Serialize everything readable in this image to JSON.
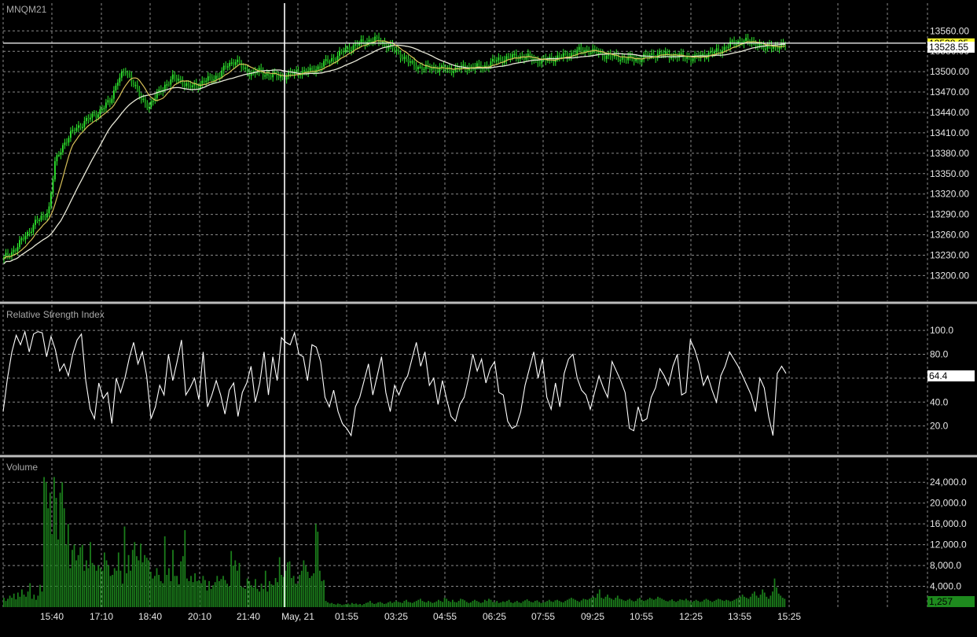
{
  "symbol": "MNQM21",
  "colors": {
    "background": "#000000",
    "candle_up": "#2ee82e",
    "candle_down": "#1a9e1a",
    "ma_fast": "#d9c25a",
    "ma_slow": "#e8e8d8",
    "rsi_line": "#ffffff",
    "volume_bar": "#1b7d1b",
    "grid": "#8a8a8a",
    "crosshair": "#ffffff",
    "last_price_tag": "#ffff33",
    "volume_tag": "#1e8a1e"
  },
  "chart_data": [
    {
      "panel": "price",
      "type": "candlestick",
      "title": "MNQM21",
      "ylim": [
        13175,
        13580
      ],
      "yticks": [
        13560,
        13530,
        13500,
        13470,
        13440,
        13410,
        13380,
        13350,
        13320,
        13290,
        13260,
        13230,
        13200
      ],
      "ytick_labels": [
        "13560.00",
        "13530.00",
        "13500.00",
        "13470.00",
        "13440.00",
        "13410.00",
        "13380.00",
        "13350.00",
        "13320.00",
        "13290.00",
        "13260.00",
        "13230.00",
        "13200.00"
      ],
      "crosshair_price": 13542,
      "crosshair_label": "13538.25",
      "last_price_label": "13528.55",
      "anchors": [
        [
          0,
          13225
        ],
        [
          6,
          13240
        ],
        [
          12,
          13262
        ],
        [
          16,
          13278
        ],
        [
          20,
          13286
        ],
        [
          23,
          13300
        ],
        [
          26,
          13365
        ],
        [
          30,
          13392
        ],
        [
          36,
          13415
        ],
        [
          42,
          13428
        ],
        [
          48,
          13440
        ],
        [
          54,
          13456
        ],
        [
          58,
          13488
        ],
        [
          62,
          13500
        ],
        [
          66,
          13485
        ],
        [
          70,
          13458
        ],
        [
          74,
          13450
        ],
        [
          78,
          13466
        ],
        [
          82,
          13480
        ],
        [
          86,
          13490
        ],
        [
          90,
          13488
        ],
        [
          94,
          13477
        ],
        [
          98,
          13480
        ],
        [
          102,
          13486
        ],
        [
          106,
          13490
        ],
        [
          110,
          13496
        ],
        [
          114,
          13510
        ],
        [
          118,
          13517
        ],
        [
          122,
          13504
        ],
        [
          126,
          13498
        ],
        [
          130,
          13500
        ],
        [
          134,
          13496
        ],
        [
          138,
          13494
        ],
        [
          142,
          13493
        ],
        [
          146,
          13496
        ],
        [
          150,
          13500
        ],
        [
          156,
          13500
        ],
        [
          162,
          13510
        ],
        [
          168,
          13520
        ],
        [
          174,
          13532
        ],
        [
          180,
          13540
        ],
        [
          186,
          13546
        ],
        [
          190,
          13547
        ],
        [
          196,
          13538
        ],
        [
          202,
          13525
        ],
        [
          208,
          13510
        ],
        [
          214,
          13505
        ],
        [
          220,
          13506
        ],
        [
          226,
          13503
        ],
        [
          232,
          13505
        ],
        [
          238,
          13507
        ],
        [
          244,
          13506
        ],
        [
          250,
          13516
        ],
        [
          256,
          13520
        ],
        [
          262,
          13523
        ],
        [
          268,
          13520
        ],
        [
          274,
          13515
        ],
        [
          280,
          13520
        ],
        [
          286,
          13523
        ],
        [
          292,
          13530
        ],
        [
          298,
          13532
        ],
        [
          304,
          13526
        ],
        [
          310,
          13522
        ],
        [
          316,
          13520
        ],
        [
          322,
          13518
        ],
        [
          328,
          13523
        ],
        [
          334,
          13526
        ],
        [
          340,
          13524
        ],
        [
          346,
          13522
        ],
        [
          352,
          13520
        ],
        [
          358,
          13526
        ],
        [
          364,
          13530
        ],
        [
          370,
          13540
        ],
        [
          376,
          13546
        ],
        [
          380,
          13543
        ],
        [
          384,
          13542
        ],
        [
          388,
          13532
        ],
        [
          390,
          13540
        ],
        [
          394,
          13536
        ],
        [
          398,
          13538
        ]
      ],
      "sma_fast_period": 10,
      "sma_slow_period": 30
    },
    {
      "panel": "rsi",
      "type": "line",
      "title": "Relative Strength Index",
      "ylim": [
        0,
        110
      ],
      "yticks": [
        100,
        80,
        60,
        40,
        20
      ],
      "ytick_labels": [
        "100.0",
        "80.0",
        "60.0",
        "40.0",
        "20.0"
      ],
      "current_value_label": "64.4",
      "values": [
        32,
        60,
        82,
        96,
        88,
        99,
        82,
        97,
        99,
        98,
        78,
        95,
        84,
        66,
        72,
        62,
        80,
        92,
        97,
        58,
        34,
        26,
        56,
        43,
        48,
        22,
        60,
        48,
        60,
        77,
        90,
        72,
        82,
        62,
        26,
        36,
        54,
        46,
        80,
        58,
        74,
        92,
        46,
        52,
        60,
        42,
        82,
        36,
        46,
        58,
        46,
        30,
        50,
        56,
        28,
        48,
        56,
        70,
        40,
        56,
        82,
        46,
        78,
        58,
        94,
        90,
        88,
        98,
        80,
        78,
        58,
        88,
        86,
        74,
        44,
        36,
        50,
        32,
        22,
        18,
        12,
        36,
        44,
        58,
        72,
        46,
        62,
        78,
        48,
        32,
        54,
        46,
        56,
        62,
        76,
        90,
        70,
        82,
        54,
        60,
        38,
        58,
        42,
        28,
        24,
        38,
        44,
        60,
        80,
        66,
        76,
        56,
        68,
        74,
        48,
        46,
        24,
        18,
        20,
        32,
        54,
        68,
        82,
        60,
        76,
        44,
        34,
        56,
        36,
        64,
        76,
        80,
        60,
        50,
        46,
        34,
        48,
        62,
        52,
        44,
        74,
        66,
        58,
        48,
        18,
        16,
        36,
        24,
        26,
        44,
        52,
        68,
        62,
        54,
        70,
        80,
        46,
        48,
        92,
        84,
        72,
        54,
        62,
        50,
        40,
        62,
        70,
        82,
        76,
        70,
        62,
        54,
        46,
        32,
        60,
        52,
        28,
        12,
        64,
        70,
        64
      ]
    },
    {
      "panel": "volume",
      "type": "bar",
      "title": "Volume",
      "ylim": [
        0,
        26000
      ],
      "yticks": [
        24000,
        20000,
        16000,
        12000,
        8000,
        4000
      ],
      "ytick_labels": [
        "24,000.0",
        "20,000.0",
        "16,000.0",
        "12,000.0",
        "8,000.0",
        "4,000.0"
      ],
      "current_value_label": "1,257",
      "values": [
        1800,
        1200,
        1600,
        2200,
        1800,
        2600,
        1500,
        2800,
        2000,
        3400,
        2400,
        2000,
        3000,
        4600,
        1600,
        2400,
        1400,
        2200,
        4300,
        3000,
        25000,
        24000,
        19000,
        22000,
        14000,
        25000,
        21000,
        13000,
        22000,
        24000,
        19000,
        12000,
        16000,
        7500,
        11000,
        12000,
        9000,
        10000,
        11500,
        12000,
        7000,
        9000,
        7500,
        12500,
        8500,
        8000,
        7000,
        8000,
        7500,
        7000,
        10500,
        9000,
        8000,
        6000,
        6200,
        7500,
        7000,
        10500,
        7000,
        4500,
        15500,
        6500,
        10000,
        7000,
        11000,
        12500,
        9800,
        9000,
        12200,
        8600,
        10000,
        9500,
        9000,
        6800,
        5500,
        6000,
        7500,
        6200,
        5000,
        4600,
        13600,
        6200,
        7500,
        5000,
        11000,
        6000,
        6000,
        4400,
        8800,
        9800,
        14800,
        5500,
        5000,
        6000,
        4800,
        6500,
        5000,
        5200,
        4600,
        6000,
        5200,
        3200,
        5000,
        3500,
        4200,
        4800,
        6000,
        5000,
        5400,
        6000,
        5200,
        4500,
        4000,
        10800,
        8000,
        9000,
        7000,
        8500,
        4000,
        3800,
        3500,
        5500,
        5000,
        4200,
        3800,
        5400,
        3500,
        3000,
        4500,
        3500,
        7000,
        3000,
        5000,
        4400,
        4200,
        5600,
        4800,
        9600,
        6200,
        5800,
        7000,
        8600,
        8800,
        5600,
        6000,
        4500,
        4500,
        6200,
        7000,
        9000,
        8000,
        6800,
        5600,
        6000,
        6500,
        16000,
        14500,
        7000,
        5000,
        5200,
        1200,
        900,
        700,
        800,
        600,
        500,
        700,
        600,
        400,
        500,
        600,
        700,
        500,
        800,
        600,
        700,
        500,
        600,
        400,
        600,
        800,
        900,
        1200,
        800,
        600,
        700,
        900,
        1000,
        800,
        600,
        700,
        900,
        1100,
        800,
        1000,
        1200,
        1000,
        900,
        800,
        1200,
        1400,
        1000,
        900,
        800,
        1000,
        1200,
        1400,
        1600,
        1200,
        1000,
        900,
        1200,
        1000,
        800,
        900,
        1100,
        1400,
        1200,
        1000,
        1800,
        1600,
        1200,
        1000,
        1400,
        1000,
        900,
        1200,
        1600,
        1500,
        1300,
        1000,
        800,
        900,
        1200,
        1400,
        1200,
        1000,
        800,
        900,
        1400,
        1200,
        1600,
        1400,
        1000,
        900,
        1200,
        800,
        900,
        1100,
        1000,
        1200,
        1400,
        900,
        800,
        1000,
        1200,
        900,
        800,
        1100,
        1300,
        1500,
        1200,
        1000,
        900,
        1200,
        1300,
        1000,
        800,
        900,
        1000,
        1200,
        1400,
        1100,
        1000,
        1300,
        1400,
        1200,
        1000,
        900,
        1200,
        1400,
        1600,
        1800,
        1600,
        1400,
        1200,
        1000,
        1300,
        1600,
        1500,
        1400,
        1600,
        1800,
        2000,
        1800,
        2600,
        3400,
        1800,
        1600,
        2000,
        2400,
        1800,
        1600,
        1400,
        1800,
        2200,
        1600,
        1500,
        1300,
        1200,
        1400,
        1600,
        1300,
        1100,
        1200,
        1600,
        1800,
        1400,
        1200,
        1300,
        1500,
        1800,
        1600,
        1400,
        1600,
        2000,
        1800,
        1600,
        1400,
        1200,
        1100,
        1300,
        1500,
        1200,
        1000,
        1200,
        1500,
        1400,
        1300,
        1600,
        1300,
        1100,
        1000,
        1200,
        1400,
        1200,
        1000,
        1100,
        1400,
        1600,
        1400,
        1200,
        1000,
        1200,
        1400,
        1600,
        1500,
        1300,
        1200,
        1400,
        1300,
        1100,
        1200,
        1400,
        1600,
        1800,
        2000,
        2400,
        2000,
        1800,
        1600,
        2000,
        2600,
        3000,
        2200,
        1800,
        2400,
        3400,
        2800,
        2000,
        1600,
        2200,
        3000,
        5500,
        3800,
        2600,
        2200,
        1800,
        1600
      ]
    }
  ],
  "x_axis": {
    "labels": [
      "15:40",
      "17:10",
      "18:40",
      "20:10",
      "21:40",
      "May, 21",
      "01:55",
      "03:25",
      "04:55",
      "06:25",
      "07:55",
      "09:25",
      "10:55",
      "12:25",
      "13:55",
      "15:25"
    ],
    "crosshair_label_index": 5
  }
}
